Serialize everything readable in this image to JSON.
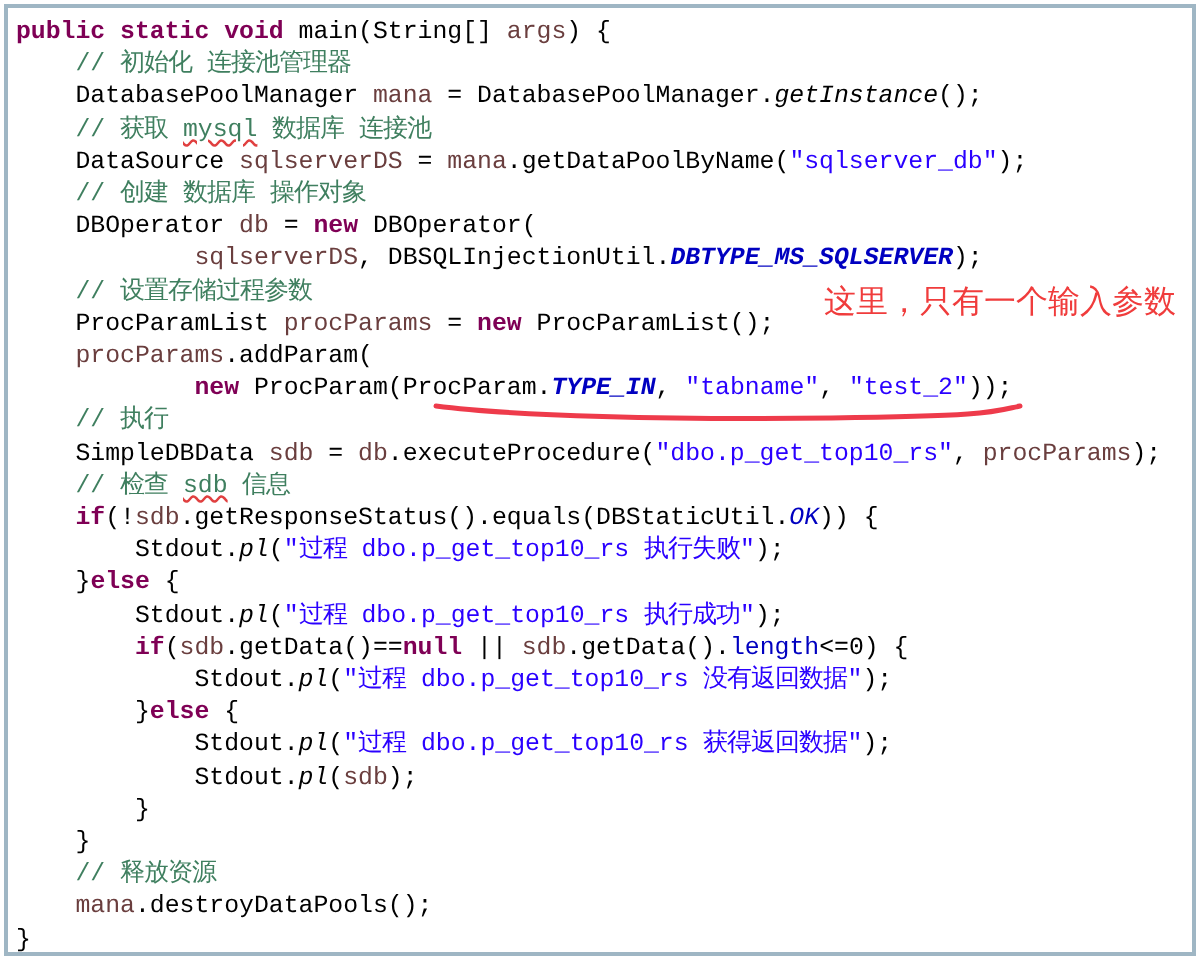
{
  "code_lines": [
    [
      {
        "kind": "keyword",
        "text": "public static void"
      },
      {
        "kind": "plain",
        "text": " main(String[] "
      },
      {
        "kind": "variable",
        "text": "args"
      },
      {
        "kind": "plain",
        "text": ") {"
      }
    ],
    [
      {
        "kind": "comment",
        "text": "    // 初始化 连接池管理器"
      }
    ],
    [
      {
        "kind": "plain",
        "text": "    DatabasePoolManager "
      },
      {
        "kind": "variable",
        "text": "mana"
      },
      {
        "kind": "plain",
        "text": " = DatabasePoolManager."
      },
      {
        "kind": "static_call",
        "text": "getInstance"
      },
      {
        "kind": "plain",
        "text": "();"
      }
    ],
    [
      {
        "kind": "comment",
        "text": "    // 获取 "
      },
      {
        "kind": "comment_flagged",
        "text": "mysql"
      },
      {
        "kind": "comment",
        "text": " 数据库 连接池"
      }
    ],
    [
      {
        "kind": "plain",
        "text": "    DataSource "
      },
      {
        "kind": "variable",
        "text": "sqlserverDS"
      },
      {
        "kind": "plain",
        "text": " = "
      },
      {
        "kind": "variable",
        "text": "mana"
      },
      {
        "kind": "plain",
        "text": ".getDataPoolByName("
      },
      {
        "kind": "string",
        "text": "\"sqlserver_db\""
      },
      {
        "kind": "plain",
        "text": ");"
      }
    ],
    [
      {
        "kind": "comment",
        "text": "    // 创建 数据库 操作对象"
      }
    ],
    [
      {
        "kind": "plain",
        "text": "    DBOperator "
      },
      {
        "kind": "variable",
        "text": "db"
      },
      {
        "kind": "plain",
        "text": " = "
      },
      {
        "kind": "keyword",
        "text": "new"
      },
      {
        "kind": "plain",
        "text": " DBOperator("
      }
    ],
    [
      {
        "kind": "variable",
        "text": "            sqlserverDS"
      },
      {
        "kind": "plain",
        "text": ", DBSQLInjectionUtil."
      },
      {
        "kind": "static_field",
        "text": "DBTYPE_MS_SQLSERVER"
      },
      {
        "kind": "plain",
        "text": ");"
      }
    ],
    [
      {
        "kind": "comment",
        "text": "    // 设置存储过程参数"
      }
    ],
    [
      {
        "kind": "plain",
        "text": "    ProcParamList "
      },
      {
        "kind": "variable",
        "text": "procParams"
      },
      {
        "kind": "plain",
        "text": " = "
      },
      {
        "kind": "keyword",
        "text": "new"
      },
      {
        "kind": "plain",
        "text": " ProcParamList();"
      }
    ],
    [
      {
        "kind": "variable",
        "text": "    procParams"
      },
      {
        "kind": "plain",
        "text": ".addParam("
      }
    ],
    [
      {
        "kind": "keyword",
        "text": "            new"
      },
      {
        "kind": "plain",
        "text": " ProcParam(ProcParam."
      },
      {
        "kind": "static_field",
        "text": "TYPE_IN"
      },
      {
        "kind": "plain",
        "text": ", "
      },
      {
        "kind": "string",
        "text": "\"tabname\""
      },
      {
        "kind": "plain",
        "text": ", "
      },
      {
        "kind": "string",
        "text": "\"test_2\""
      },
      {
        "kind": "plain",
        "text": "));"
      }
    ],
    [
      {
        "kind": "comment",
        "text": "    // 执行"
      }
    ],
    [
      {
        "kind": "plain",
        "text": "    SimpleDBData "
      },
      {
        "kind": "variable",
        "text": "sdb"
      },
      {
        "kind": "plain",
        "text": " = "
      },
      {
        "kind": "variable",
        "text": "db"
      },
      {
        "kind": "plain",
        "text": ".executeProcedure("
      },
      {
        "kind": "string",
        "text": "\"dbo.p_get_top10_rs\""
      },
      {
        "kind": "plain",
        "text": ", "
      },
      {
        "kind": "variable",
        "text": "procParams"
      },
      {
        "kind": "plain",
        "text": ");"
      }
    ],
    [
      {
        "kind": "comment",
        "text": "    // 检查 "
      },
      {
        "kind": "comment_flagged",
        "text": "sdb"
      },
      {
        "kind": "comment",
        "text": " 信息"
      }
    ],
    [
      {
        "kind": "keyword",
        "text": "    if"
      },
      {
        "kind": "plain",
        "text": "(!"
      },
      {
        "kind": "variable",
        "text": "sdb"
      },
      {
        "kind": "plain",
        "text": ".getResponseStatus().equals(DBStaticUtil."
      },
      {
        "kind": "constant",
        "text": "OK"
      },
      {
        "kind": "plain",
        "text": ")) {"
      }
    ],
    [
      {
        "kind": "plain",
        "text": "        Stdout."
      },
      {
        "kind": "static_call",
        "text": "pl"
      },
      {
        "kind": "plain",
        "text": "("
      },
      {
        "kind": "string",
        "text": "\"过程 dbo.p_get_top10_rs 执行失败\""
      },
      {
        "kind": "plain",
        "text": ");"
      }
    ],
    [
      {
        "kind": "plain",
        "text": "    }"
      },
      {
        "kind": "keyword",
        "text": "else"
      },
      {
        "kind": "plain",
        "text": " {"
      }
    ],
    [
      {
        "kind": "plain",
        "text": "        Stdout."
      },
      {
        "kind": "static_call",
        "text": "pl"
      },
      {
        "kind": "plain",
        "text": "("
      },
      {
        "kind": "string",
        "text": "\"过程 dbo.p_get_top10_rs 执行成功\""
      },
      {
        "kind": "plain",
        "text": ");"
      }
    ],
    [
      {
        "kind": "keyword",
        "text": "        if"
      },
      {
        "kind": "plain",
        "text": "("
      },
      {
        "kind": "variable",
        "text": "sdb"
      },
      {
        "kind": "plain",
        "text": ".getData()=="
      },
      {
        "kind": "keyword",
        "text": "null"
      },
      {
        "kind": "plain",
        "text": " || "
      },
      {
        "kind": "variable",
        "text": "sdb"
      },
      {
        "kind": "plain",
        "text": ".getData()."
      },
      {
        "kind": "member",
        "text": "length"
      },
      {
        "kind": "plain",
        "text": "<=0) {"
      }
    ],
    [
      {
        "kind": "plain",
        "text": "            Stdout."
      },
      {
        "kind": "static_call",
        "text": "pl"
      },
      {
        "kind": "plain",
        "text": "("
      },
      {
        "kind": "string",
        "text": "\"过程 dbo.p_get_top10_rs 没有返回数据\""
      },
      {
        "kind": "plain",
        "text": ");"
      }
    ],
    [
      {
        "kind": "plain",
        "text": "        }"
      },
      {
        "kind": "keyword",
        "text": "else"
      },
      {
        "kind": "plain",
        "text": " {"
      }
    ],
    [
      {
        "kind": "plain",
        "text": "            Stdout."
      },
      {
        "kind": "static_call",
        "text": "pl"
      },
      {
        "kind": "plain",
        "text": "("
      },
      {
        "kind": "string",
        "text": "\"过程 dbo.p_get_top10_rs 获得返回数据\""
      },
      {
        "kind": "plain",
        "text": ");"
      }
    ],
    [
      {
        "kind": "plain",
        "text": "            Stdout."
      },
      {
        "kind": "static_call",
        "text": "pl"
      },
      {
        "kind": "plain",
        "text": "("
      },
      {
        "kind": "variable",
        "text": "sdb"
      },
      {
        "kind": "plain",
        "text": ");"
      }
    ],
    [
      {
        "kind": "plain",
        "text": "        }"
      }
    ],
    [
      {
        "kind": "plain",
        "text": "    }"
      }
    ],
    [
      {
        "kind": "comment",
        "text": "    // 释放资源"
      }
    ],
    [
      {
        "kind": "variable",
        "text": "    mana"
      },
      {
        "kind": "plain",
        "text": ".destroyDataPools();"
      }
    ],
    [
      {
        "kind": "plain",
        "text": "}"
      }
    ]
  ],
  "annotation": {
    "note": "这里，只有一个输入参数"
  }
}
